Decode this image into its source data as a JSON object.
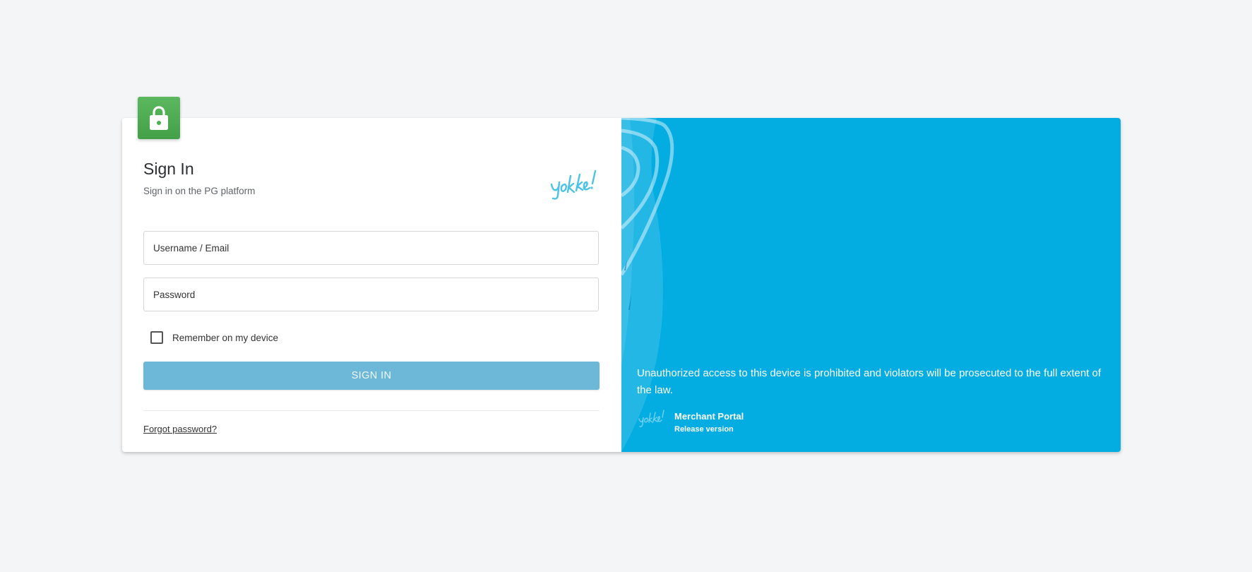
{
  "signin": {
    "title": "Sign In",
    "subtitle": "Sign in on the PG platform",
    "brand_logo": "yokke-logo",
    "username_placeholder": "Username / Email",
    "password_placeholder": "Password",
    "remember_label": "Remember on my device",
    "remember_checked": false,
    "signin_button": "SIGN IN",
    "forgot_link": "Forgot password?"
  },
  "panel": {
    "notice": "Unauthorized access to this device is prohibited and violators will be prosecuted to the full extent of the law.",
    "portal_name": "Merchant Portal",
    "release": "Release version",
    "logo": "yokke-logo"
  },
  "colors": {
    "accent": "#03ade2",
    "lock_badge": "#4caf50",
    "button": "#6db7d9",
    "logo": "#4cc3e6",
    "background": "#f4f5f7"
  },
  "icons": {
    "lock": "lock-icon",
    "checkbox": "checkbox-icon"
  }
}
